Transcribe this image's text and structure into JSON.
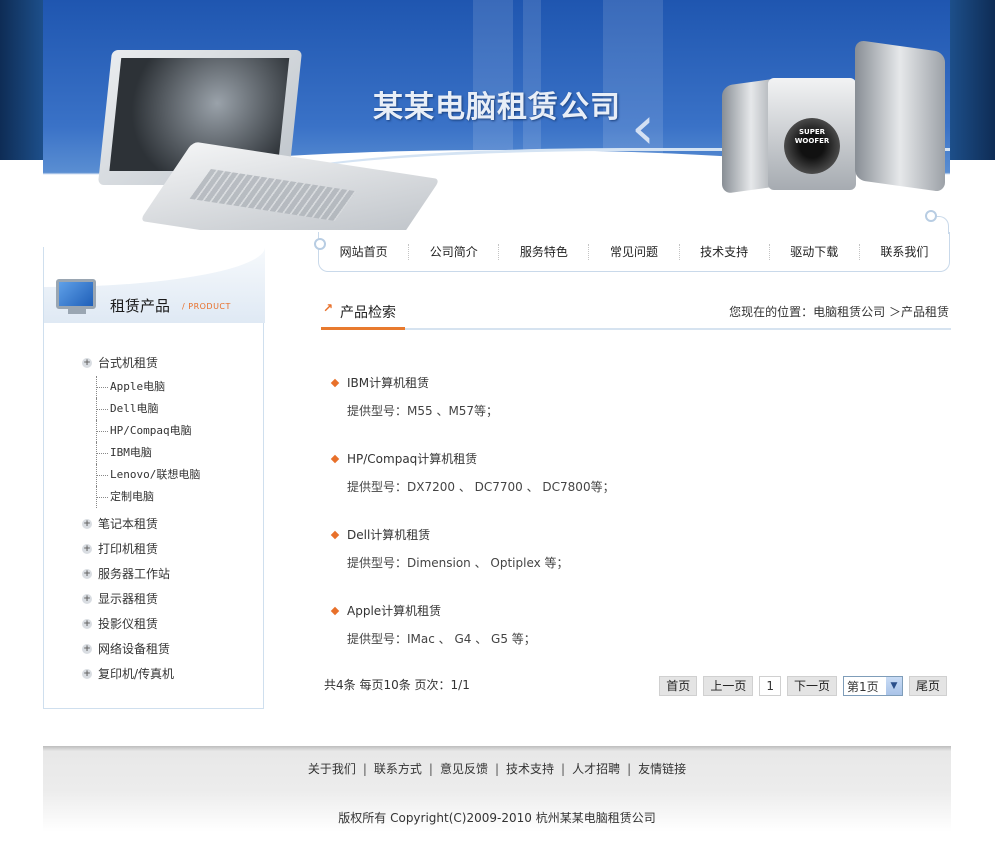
{
  "brand": {
    "title": "某某电脑租赁公司"
  },
  "speaker_label": [
    "SUPER",
    "WOOFER"
  ],
  "nav": [
    "网站首页",
    "公司简介",
    "服务特色",
    "常见问题",
    "技术支持",
    "驱动下载",
    "联系我们"
  ],
  "sidebar": {
    "title": "租赁产品",
    "subtitle": "/ PRODUCT",
    "first_category": "台式机租赁",
    "sub_items": [
      "Apple电脑",
      "Dell电脑",
      "HP/Compaq电脑",
      "IBM电脑",
      "Lenovo/联想电脑",
      "定制电脑"
    ],
    "categories": [
      "笔记本租赁",
      "打印机租赁",
      "服务器工作站",
      "显示器租赁",
      "投影仪租赁",
      "网络设备租赁",
      "复印机/传真机"
    ]
  },
  "main": {
    "section_title": "产品检索",
    "location": "您现在的位置：电脑租赁公司 ＞产品租赁",
    "products": [
      {
        "name": "IBM计算机租赁",
        "models": "提供型号：M55 、M57等；"
      },
      {
        "name": "HP/Compaq计算机租赁",
        "models": "提供型号：DX7200 、 DC7700 、 DC7800等；"
      },
      {
        "name": "Dell计算机租赁",
        "models": "提供型号：Dimension 、 Optiplex 等；"
      },
      {
        "name": "Apple计算机租赁",
        "models": "提供型号：IMac 、 G4 、 G5 等；"
      }
    ],
    "pager": {
      "info": "共4条 每页10条 页次：1/1",
      "first": "首页",
      "prev": "上一页",
      "current": "1",
      "next": "下一页",
      "select_value": "第1页",
      "last": "尾页"
    }
  },
  "footer": {
    "links": [
      "关于我们",
      "联系方式",
      "意见反馈",
      "技术支持",
      "人才招聘",
      "友情链接"
    ],
    "copyright": "版权所有 Copyright(C)2009-2010 杭州某某电脑租赁公司"
  },
  "colors": {
    "accent": "#e8702a",
    "banner_blue": "#2a62b8",
    "border": "#cfdfee"
  }
}
